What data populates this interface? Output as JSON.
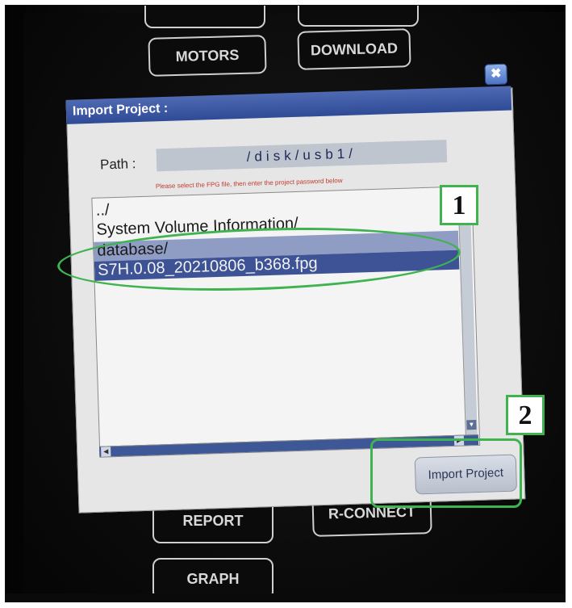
{
  "background_buttons": {
    "motors": "MOTORS",
    "download": "DOWNLOAD",
    "report": "REPORT",
    "rconnect": "R-CONNECT",
    "graph": "GRAPH"
  },
  "dialog": {
    "title": "Import Project :",
    "close_symbol": "✖",
    "path_label": "Path :",
    "path_value": "/disk/usb1/",
    "hint": "Please select the FPG file, then enter the project password below",
    "files": [
      "../",
      "System Volume Information/",
      "database/",
      "S7H.0.08_20210806_b368.fpg"
    ],
    "import_button": "Import Project"
  },
  "annotations": {
    "step1": "1",
    "step2": "2"
  },
  "colors": {
    "annotation": "#3fb34f",
    "titlebar": "#2f4b96",
    "selection": "#3d5396"
  },
  "icons": {
    "close": "close-icon",
    "scroll_up": "arrow-up-icon",
    "scroll_down": "arrow-down-icon",
    "scroll_left": "arrow-left-icon",
    "scroll_right": "arrow-right-icon"
  }
}
